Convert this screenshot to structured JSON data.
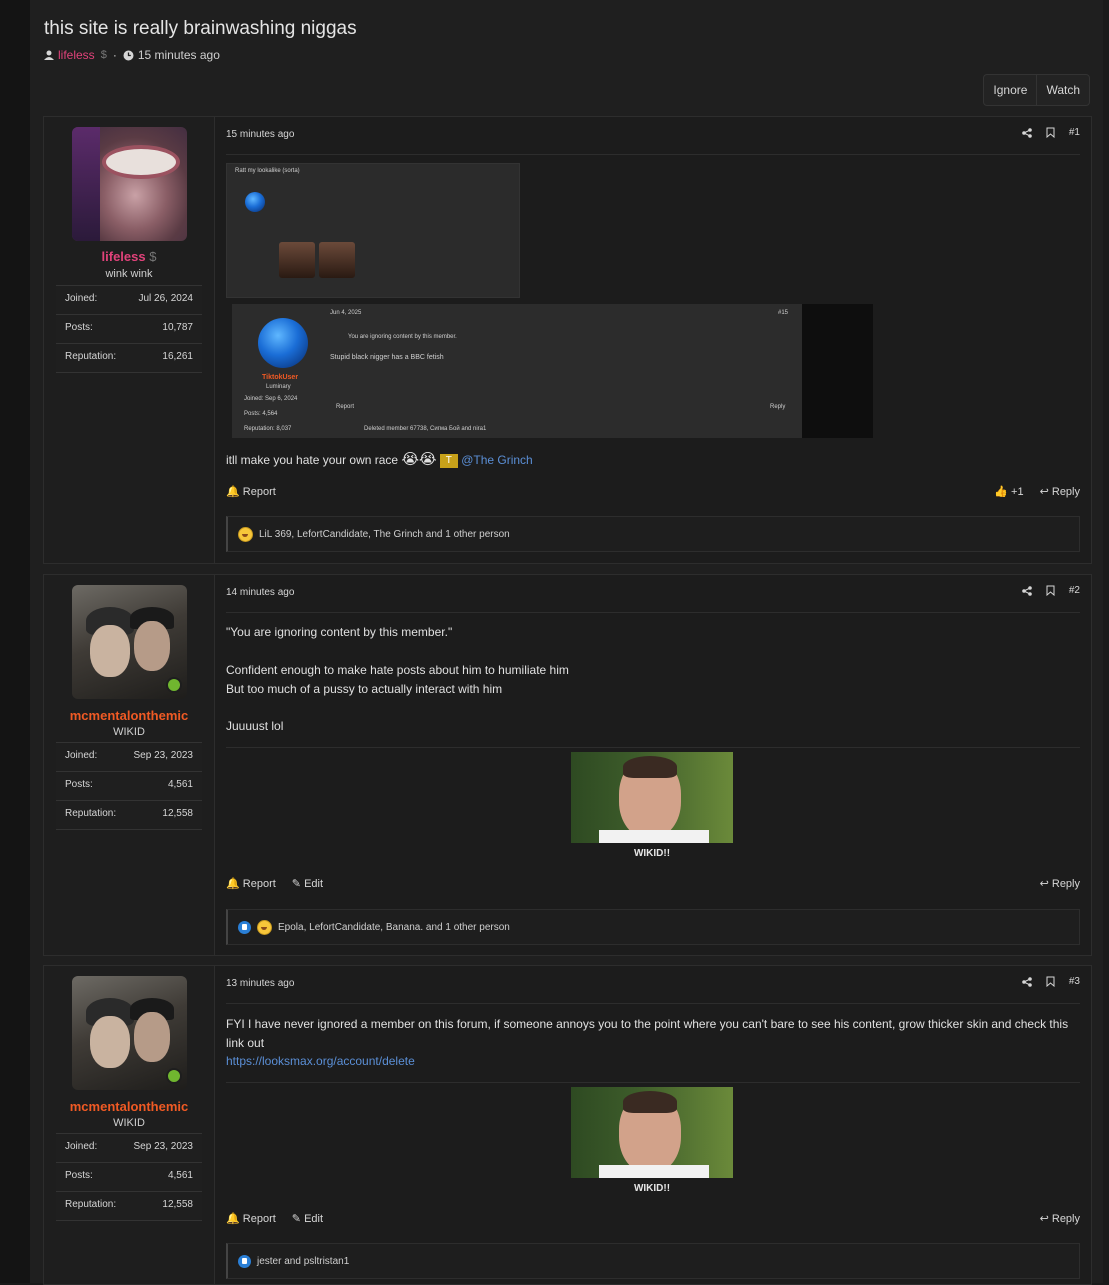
{
  "thread": {
    "title": "this site is really brainwashing niggas",
    "author": "lifeless",
    "author_badge": "$",
    "separator": "·",
    "time": "15 minutes ago",
    "actions": {
      "ignore": "Ignore",
      "watch": "Watch"
    }
  },
  "posts": [
    {
      "number": "#1",
      "time": "15 minutes ago",
      "user": {
        "name": "lifeless",
        "badge": "$",
        "title": "wink wink",
        "joined_label": "Joined:",
        "joined": "Jul 26, 2024",
        "posts_label": "Posts:",
        "posts": "10,787",
        "rep_label": "Reputation:",
        "reputation": "16,261"
      },
      "embedded": {
        "shot1_title": "Ratt my lookalike (sorta)",
        "shot2_date": "Jun 4, 2025",
        "shot2_number": "#15",
        "shot2_ignore": "You are ignoring content by this member.",
        "shot2_text": "Stupid black nigger has a BBC fetish",
        "shot2_user": "TiktokUser",
        "shot2_rank": "Luminary",
        "shot2_joined_label": "Joined:",
        "shot2_joined": "Sep 6, 2024",
        "shot2_posts_label": "Posts:",
        "shot2_posts": "4,564",
        "shot2_rep_label": "Reputation:",
        "shot2_rep": "8,037",
        "shot2_report": "Report",
        "shot2_reply": "Reply",
        "shot2_reactions": "Deleted member 67738, Сигма Бой and nira1"
      },
      "text": "itll make you hate your own race",
      "emoji": "😭😭",
      "badge": "T",
      "mention": "@The Grinch",
      "report": "Report",
      "like_count": "+1",
      "reply": "Reply",
      "reactions": "LiL 369, LefortCandidate, The Grinch and 1 other person"
    },
    {
      "number": "#2",
      "time": "14 minutes ago",
      "user": {
        "name": "mcmentalonthemic",
        "title": "WIKID",
        "joined_label": "Joined:",
        "joined": "Sep 23, 2023",
        "posts_label": "Posts:",
        "posts": "4,561",
        "rep_label": "Reputation:",
        "reputation": "12,558"
      },
      "quote": "\"You are ignoring content by this member.\"",
      "line1": "Confident enough to make hate posts about him to humiliate him",
      "line2": "But too much of a pussy to actually interact with him",
      "line3": "Juuuust lol",
      "caption": "WIKID!!",
      "report": "Report",
      "edit": "Edit",
      "reply": "Reply",
      "reactions": "Epola, LefortCandidate, Banana. and 1 other person"
    },
    {
      "number": "#3",
      "time": "13 minutes ago",
      "user": {
        "name": "mcmentalonthemic",
        "title": "WIKID",
        "joined_label": "Joined:",
        "joined": "Sep 23, 2023",
        "posts_label": "Posts:",
        "posts": "4,561",
        "rep_label": "Reputation:",
        "reputation": "12,558"
      },
      "text": "FYI I have never ignored a member on this forum, if someone annoys you to the point where you can't bare to see his content, grow thicker skin and check this link out",
      "link": "https://looksmax.org/account/delete",
      "caption": "WIKID!!",
      "report": "Report",
      "edit": "Edit",
      "reply": "Reply",
      "reactions": "jester and psltristan1"
    }
  ],
  "colors": {
    "author_pink": "#e0427a",
    "author_orange": "#f05a24",
    "link_blue": "#5b8fd6",
    "online_green": "#70b62f"
  }
}
